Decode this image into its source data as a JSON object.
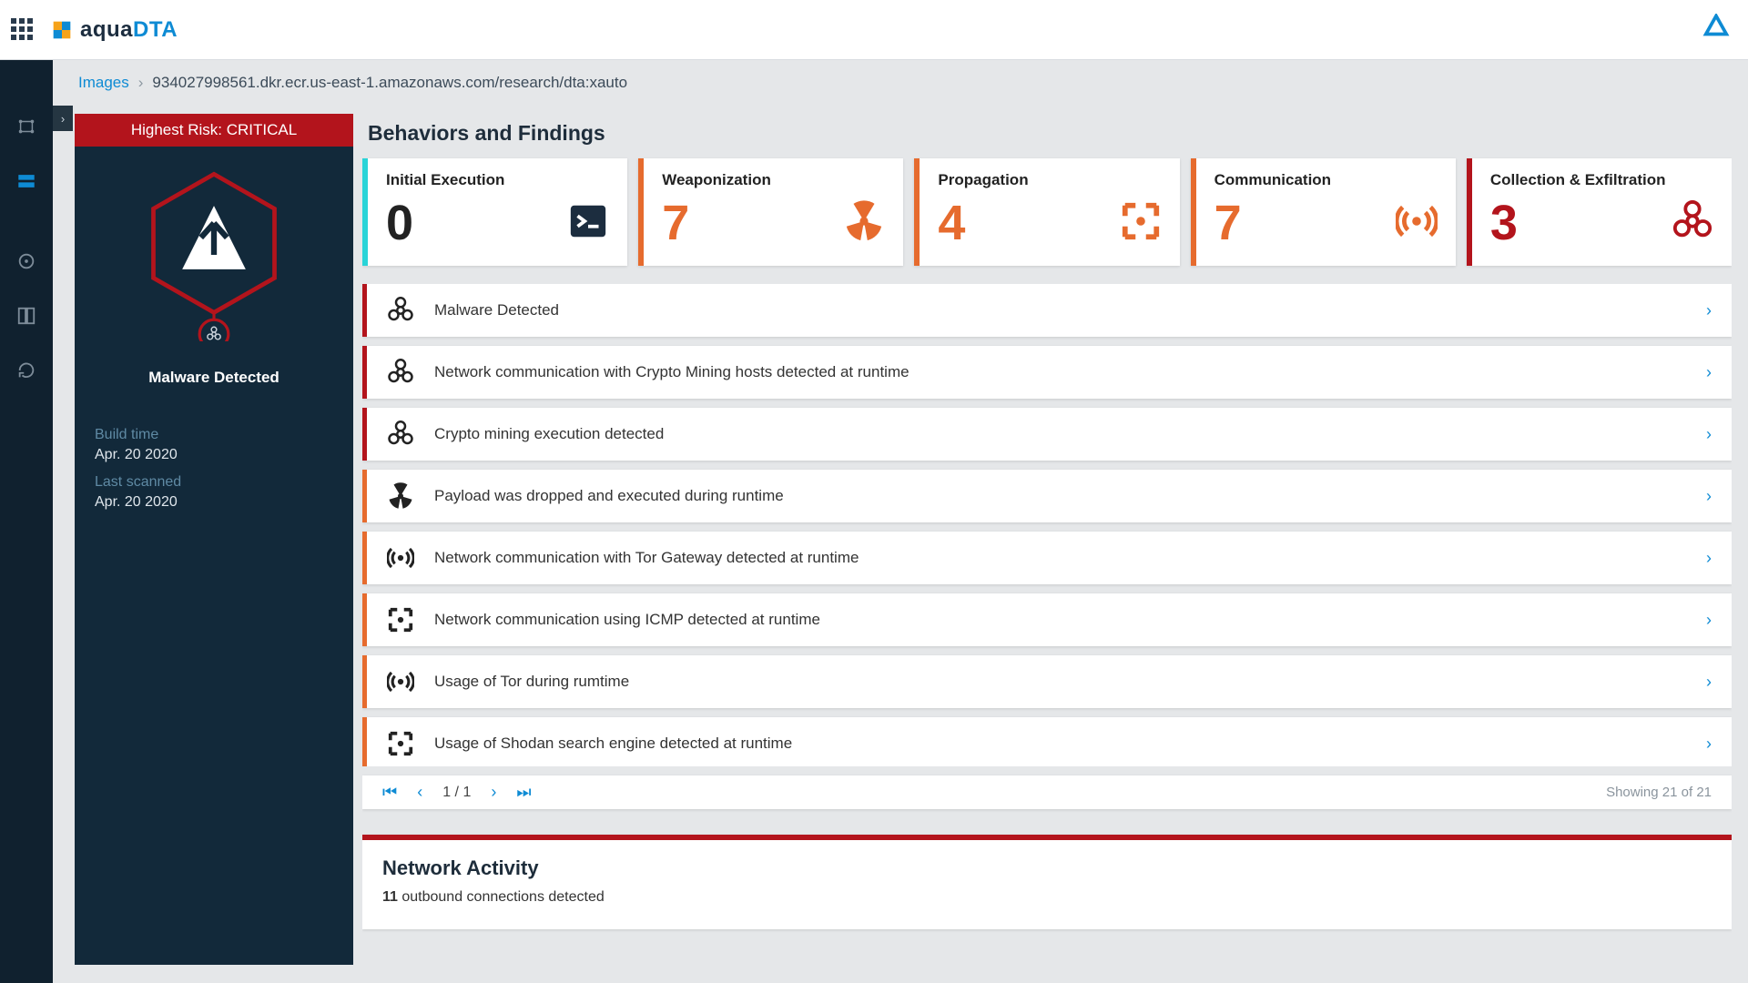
{
  "brand": {
    "name_main": "aqua",
    "name_suffix": "DTA"
  },
  "breadcrumb": {
    "root": "Images",
    "current": "934027998561.dkr.ecr.us-east-1.amazonaws.com/research/dta:xauto"
  },
  "risk_banner": "Highest Risk: CRITICAL",
  "hex_label": "Malware Detected",
  "meta": {
    "build_time_key": "Build time",
    "build_time_val": "Apr. 20 2020",
    "last_scanned_key": "Last scanned",
    "last_scanned_val": "Apr. 20 2020"
  },
  "behaviors_title": "Behaviors and Findings",
  "stages": [
    {
      "key": "execution",
      "title": "Initial Execution",
      "count": "0",
      "icon": "terminal"
    },
    {
      "key": "weapon",
      "title": "Weaponization",
      "count": "7",
      "icon": "radiation"
    },
    {
      "key": "propagation",
      "title": "Propagation",
      "count": "4",
      "icon": "expand"
    },
    {
      "key": "communication",
      "title": "Communication",
      "count": "7",
      "icon": "broadcast"
    },
    {
      "key": "exfil",
      "title": "Collection & Exfiltration",
      "count": "3",
      "icon": "biohazard"
    }
  ],
  "findings": [
    {
      "sev": "red",
      "icon": "biohazard",
      "text": "Malware Detected"
    },
    {
      "sev": "red",
      "icon": "biohazard",
      "text": "Network communication with Crypto Mining hosts detected at runtime"
    },
    {
      "sev": "red",
      "icon": "biohazard",
      "text": "Crypto mining execution detected"
    },
    {
      "sev": "orange",
      "icon": "radiation",
      "text": "Payload was dropped and executed during runtime"
    },
    {
      "sev": "orange",
      "icon": "broadcast",
      "text": "Network communication with Tor Gateway detected at runtime"
    },
    {
      "sev": "orange",
      "icon": "expand",
      "text": "Network communication using ICMP detected at runtime"
    },
    {
      "sev": "orange",
      "icon": "broadcast",
      "text": "Usage of Tor during rumtime"
    },
    {
      "sev": "orange",
      "icon": "expand",
      "text": "Usage of Shodan search engine detected at runtime"
    }
  ],
  "pager": {
    "page_indicator": "1 / 1",
    "showing": "Showing 21 of 21"
  },
  "network": {
    "title": "Network Activity",
    "count": "11",
    "suffix": " outbound connections detected"
  }
}
